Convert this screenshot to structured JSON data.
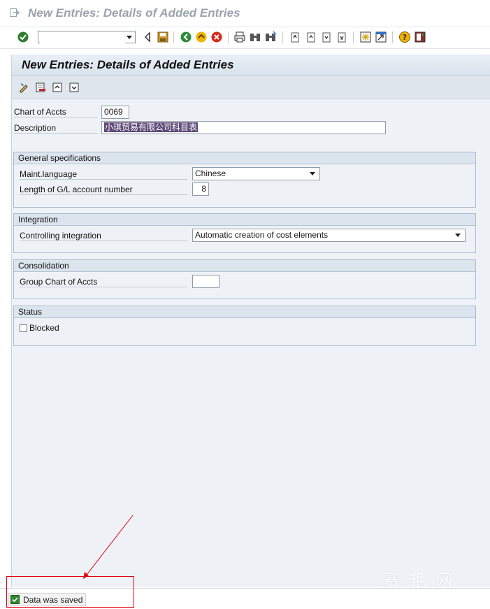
{
  "window": {
    "title": "New Entries: Details of Added Entries"
  },
  "std_toolbar": {
    "command_field_value": "",
    "icons": [
      "enter-icon",
      "back-icon",
      "save-icon",
      "back-green-icon",
      "exit-icon",
      "cancel-icon",
      "print-icon",
      "find-icon",
      "find-next-icon",
      "first-page-icon",
      "previous-page-icon",
      "next-page-icon",
      "last-page-icon",
      "create-session-icon",
      "shortcut-icon",
      "help-icon",
      "layout-icon"
    ]
  },
  "screen": {
    "header_title": "New Entries: Details of Added Entries",
    "app_toolbar_icons": [
      "change-icon",
      "delete-icon",
      "previous-entry-icon",
      "next-entry-icon"
    ]
  },
  "form": {
    "chart_label": "Chart of Accts",
    "chart_value": "0069",
    "description_label": "Description",
    "description_value": "小琪贸易有限公司科目表"
  },
  "groups": {
    "general": {
      "title": "General specifications",
      "maint_language_label": "Maint.language",
      "maint_language_value": "Chinese",
      "gl_length_label": "Length of G/L account number",
      "gl_length_value": "8"
    },
    "integration": {
      "title": "Integration",
      "controlling_label": "Controlling integration",
      "controlling_value": "Automatic creation of cost elements"
    },
    "consolidation": {
      "title": "Consolidation",
      "group_chart_label": "Group Chart of Accts",
      "group_chart_value": ""
    },
    "status": {
      "title": "Status",
      "blocked_label": "Blocked",
      "blocked_checked": false
    }
  },
  "status_bar": {
    "message": "Data was saved",
    "type": "success"
  },
  "watermark": "赛 艳 网",
  "colors": {
    "annotation": "#e60012",
    "highlight": "#5e4a78",
    "screen_bg": "#eef2f7"
  }
}
